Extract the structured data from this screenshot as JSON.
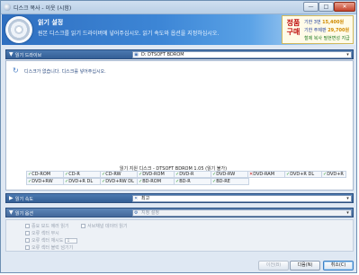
{
  "window": {
    "title": "디스크 복사 - 이웃 (시험)"
  },
  "controls": {
    "minimize": "—",
    "maximize": "□",
    "close": "✕"
  },
  "header": {
    "title": "읽기 설정",
    "description": "원본 디스크를 읽기 드라이버에 넣어주십시오. 읽기 속도와 옵션을 지정하십시오."
  },
  "license": {
    "badge": "정품 구매",
    "line1_label": "기한 3번",
    "line1_value": "15,400원",
    "line2_label": "기한 주제판",
    "line2_value": "29,700원",
    "line3": "철제 복사 필현변성 지급"
  },
  "read_drive": {
    "section_label": "읽기 드라이브",
    "selected": "D: DTSOFT BDROM",
    "message": "디스크가 없습니다. 디스크를 넣어주십시오."
  },
  "supported": {
    "title": "읽기 지원 디스크 - DTSOFT BDROM 1.05 (읽기 불가)",
    "row1": [
      {
        "label": "CD-ROM",
        "ok": true
      },
      {
        "label": "CD-R",
        "ok": true
      },
      {
        "label": "CD-RW",
        "ok": true
      },
      {
        "label": "DVD-ROM",
        "ok": true
      },
      {
        "label": "DVD-R",
        "ok": true
      },
      {
        "label": "DVD-RW",
        "ok": true
      },
      {
        "label": "DVD-RAM",
        "ok": false
      },
      {
        "label": "DVD+R DL",
        "ok": true
      },
      {
        "label": "DVD+R",
        "ok": true
      }
    ],
    "row2": [
      {
        "label": "DVD+RW",
        "ok": true
      },
      {
        "label": "DVD+R DL",
        "ok": true
      },
      {
        "label": "DVD+RW DL",
        "ok": true
      },
      {
        "label": "BD-ROM",
        "ok": true
      },
      {
        "label": "BD-R",
        "ok": true
      },
      {
        "label": "BD-RE",
        "ok": true
      }
    ]
  },
  "read_speed": {
    "section_label": "읽기 속도",
    "selected": "최고"
  },
  "read_options": {
    "section_label": "읽기 옵션",
    "selected": "지정 설정",
    "opt1": "중요 모드 에러 읽기",
    "opt2": "서브채널 데이터 읽기",
    "opt3": "오류 섹터 무시",
    "opt4_label": "오류 섹터 재시도",
    "opt4_value": "1",
    "opt5": "오류 섹터 블럭 넘기기"
  },
  "buttons": {
    "prev": "이전(B)",
    "next": "다음(N)",
    "cancel": "취소(C)"
  }
}
